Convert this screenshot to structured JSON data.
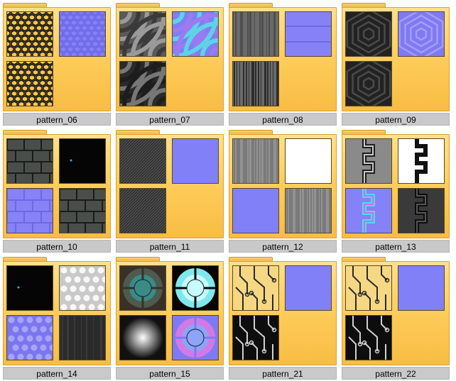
{
  "folders": [
    {
      "label": "pattern_06",
      "thumbs": [
        "hex-dark-icon",
        "hex-normal-icon",
        "hex-dark-icon"
      ]
    },
    {
      "label": "pattern_07",
      "thumbs": [
        "arcs-gray-icon",
        "arcs-normal-icon",
        "arcs-dark-icon"
      ]
    },
    {
      "label": "pattern_08",
      "thumbs": [
        "grunge-wall-icon",
        "planks-normal-icon",
        "grunge-streak-icon"
      ]
    },
    {
      "label": "pattern_09",
      "thumbs": [
        "hexline-dark-icon",
        "hexline-normal-icon",
        "hexline-dark-icon"
      ]
    },
    {
      "label": "pattern_10",
      "thumbs": [
        "stone-bricks-icon",
        "black-square-icon",
        "bricks-normal-icon",
        "stone-bricks-icon"
      ]
    },
    {
      "label": "pattern_11",
      "thumbs": [
        "diagonal-lines-icon",
        "flat-normal-icon",
        "diagonal-lines-icon"
      ]
    },
    {
      "label": "pattern_12",
      "thumbs": [
        "brushed-metal-icon",
        "white-square-icon",
        "flat-normal-icon",
        "brushed-metal-icon"
      ]
    },
    {
      "label": "pattern_13",
      "thumbs": [
        "zigzag-gray-icon",
        "zigzag-white-icon",
        "zigzag-normal-icon",
        "zigzag-dark-icon"
      ]
    },
    {
      "label": "pattern_14",
      "thumbs": [
        "black-square-icon",
        "dots-white-icon",
        "dots-normal-icon",
        "dark-noise-icon"
      ]
    },
    {
      "label": "pattern_15",
      "thumbs": [
        "speaker-teal-icon",
        "speaker-glow-icon",
        "radial-gradient-icon",
        "speaker-normal-icon"
      ]
    },
    {
      "label": "pattern_21",
      "thumbs": [
        "circuit-yellow-icon",
        "flat-normal-icon",
        "circuit-dark-icon"
      ]
    },
    {
      "label": "pattern_22",
      "thumbs": [
        "circuit-yellow-icon",
        "flat-normal-icon",
        "circuit-dark-icon"
      ]
    }
  ]
}
